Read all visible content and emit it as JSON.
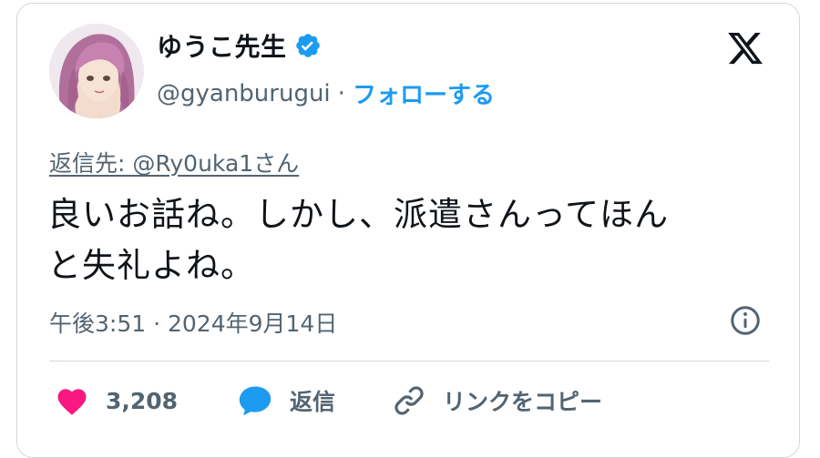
{
  "author": {
    "display_name": "ゆうこ先生",
    "handle": "@gyanburugui",
    "separator": "·",
    "follow_label": "フォローする"
  },
  "tweet": {
    "reply_to": "返信先: @Ry0uka1さん",
    "text_lines": [
      "良いお話ね。しかし、派遣さんってほん",
      "と失礼よね。"
    ],
    "timestamp": "午後3:51 · 2024年9月14日"
  },
  "actions": {
    "like_count": "3,208",
    "reply_label": "返信",
    "copy_link_label": "リンクをコピー"
  },
  "colors": {
    "like": "#f91880",
    "reply": "#1d9bf0",
    "verified": "#1d9bf0",
    "follow": "#1d9bf0",
    "muted_text": "#536471"
  },
  "icons": [
    "verified-badge-icon",
    "x-logo-icon",
    "info-icon",
    "heart-icon",
    "reply-bubble-icon",
    "link-icon"
  ]
}
